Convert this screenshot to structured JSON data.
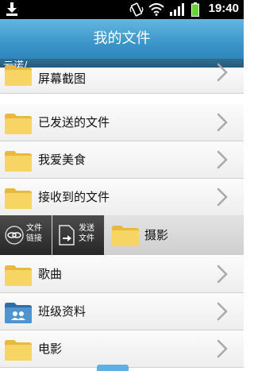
{
  "statusbar": {
    "time": "19:40"
  },
  "titlebar": {
    "title": "我的文件"
  },
  "path": {
    "text": "云诺/"
  },
  "items": [
    {
      "label": "屏幕截图",
      "icon": "folder"
    },
    {
      "label": "已发送的文件",
      "icon": "folder"
    },
    {
      "label": "我爱美食",
      "icon": "folder"
    },
    {
      "label": "接收到的文件",
      "icon": "folder"
    },
    {
      "label": "歌曲",
      "icon": "folder"
    },
    {
      "label": "班级资料",
      "icon": "shared-folder"
    },
    {
      "label": "电影",
      "icon": "folder"
    }
  ],
  "action_row": {
    "file_link": {
      "line1": "文件",
      "line2": "链接"
    },
    "send_file": {
      "line1": "发送",
      "line2": "文件"
    },
    "selected": {
      "label": "摄影"
    }
  },
  "colors": {
    "accent": "#3b96c9",
    "path_bar": "#1e4f6e",
    "folder": "#f5cf59"
  }
}
